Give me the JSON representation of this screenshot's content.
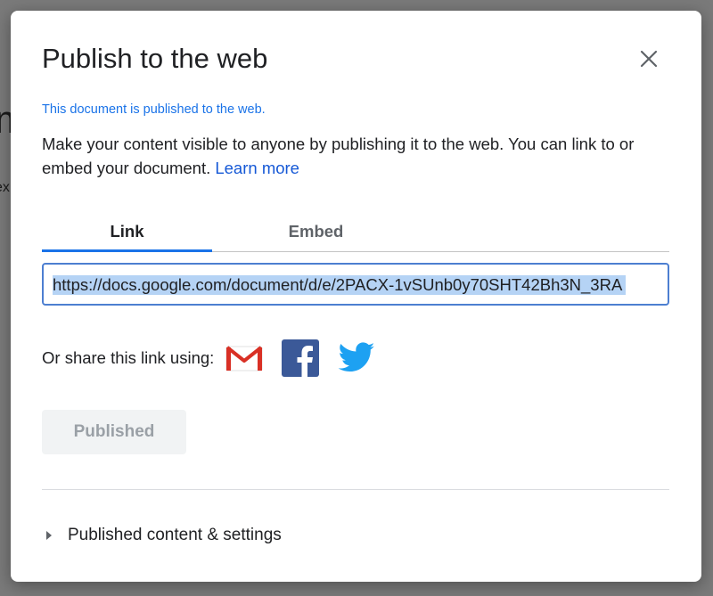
{
  "dialog": {
    "title": "Publish to the web",
    "status": "This document is published to the web.",
    "description": "Make your content visible to anyone by publishing it to the web. You can link to or embed your document.",
    "learn_more": "Learn more",
    "tabs": [
      {
        "label": "Link",
        "active": true
      },
      {
        "label": "Embed",
        "active": false
      }
    ],
    "url_value": "https://docs.google.com/document/d/e/2PACX-1vSUnb0y70SHT42Bh3N_3RA",
    "share_label": "Or share this link using:",
    "share_icons": [
      "gmail-icon",
      "facebook-icon",
      "twitter-icon"
    ],
    "published_button": "Published",
    "settings_label": "Published content & settings"
  },
  "colors": {
    "accent": "#1a73e8",
    "link": "#1558d6",
    "selection": "#b5d3f5",
    "gmail_red": "#d93025",
    "facebook_blue": "#3b5998",
    "twitter_blue": "#1da1f2"
  }
}
